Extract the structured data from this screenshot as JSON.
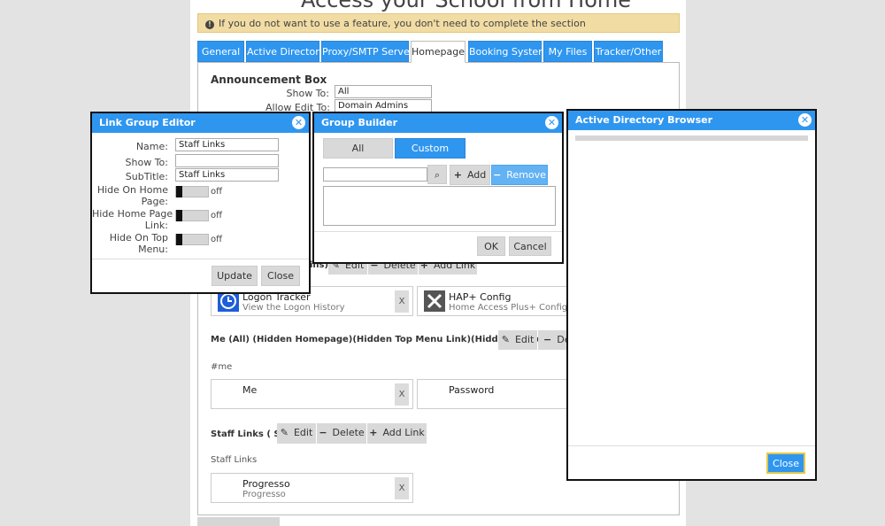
{
  "page": {
    "title": "Access your School from Home",
    "banner": "If you do not want to use a feature, you don't need to complete the section"
  },
  "tabs": [
    "General",
    "Active Directory",
    "Proxy/SMTP Server",
    "Homepage",
    "Booking System",
    "My Files",
    "Tracker/Other"
  ],
  "announcement": {
    "title": "Announcement Box",
    "show_to_label": "Show To:",
    "show_to_value": "All",
    "allow_edit_label": "Allow Edit To:",
    "allow_edit_value": "Domain Admins"
  },
  "groups": [
    {
      "header": "Me (All) (Hidden Homepage)(Hidden Top Menu Link)(Hidden Homepage Link)",
      "tag": "#me",
      "tiles": [
        {
          "name": "Me",
          "sub": ""
        },
        {
          "name": "Password",
          "sub": ""
        }
      ]
    },
    {
      "header": "Staff Links ( Staff)",
      "tag": "Staff Links",
      "tiles": [
        {
          "name": "Progresso",
          "sub": "Progresso"
        }
      ]
    }
  ],
  "partial_group_header": "ins)",
  "tiles_row1": [
    {
      "name": "Logon Tracker",
      "sub": "View the Logon History",
      "icon": "clock-icon"
    },
    {
      "name": "HAP+ Config",
      "sub": "Home Access Plus+ Config",
      "icon": "tools-icon"
    }
  ],
  "actions": {
    "edit": "Edit",
    "delete": "Delete",
    "add_link": "Add Link",
    "tile_remove": "X"
  },
  "link_group_editor": {
    "title": "Link Group Editor",
    "name_label": "Name:",
    "name_value": "Staff Links",
    "show_to_label": "Show To:",
    "show_to_value": "",
    "subtitle_label": "SubTitle:",
    "subtitle_value": "Staff Links",
    "hide_home_label_1": "Hide On Home",
    "hide_home_label_2": "Page:",
    "hide_link_label_1": "Hide Home Page",
    "hide_link_label_2": "Link:",
    "hide_top_label_1": "Hide On Top",
    "hide_top_label_2": "Menu:",
    "toggle_state": "off",
    "update": "Update",
    "close": "Close"
  },
  "group_builder": {
    "title": "Group Builder",
    "tab_all": "All",
    "tab_custom": "Custom",
    "add": "Add",
    "remove": "Remove",
    "ok": "OK",
    "cancel": "Cancel"
  },
  "ad_browser": {
    "title": "Active Directory Browser",
    "close": "Close"
  },
  "colors": {
    "accent": "#2f96f0",
    "banner": "#f1dca4",
    "button_gray": "#d9d9d9"
  }
}
